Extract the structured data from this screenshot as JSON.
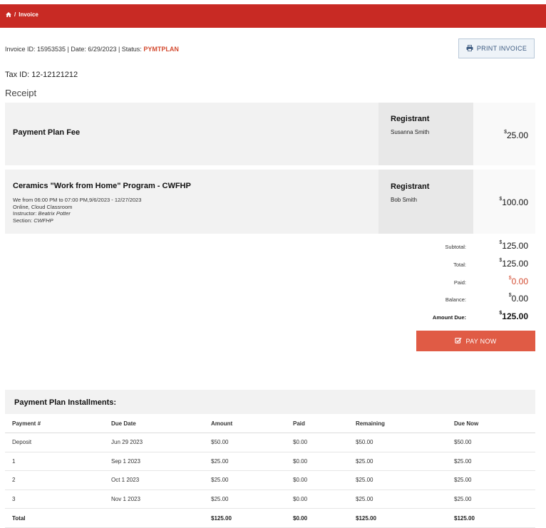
{
  "breadcrumb": {
    "home_icon": "home-icon",
    "separator": "/",
    "current": "Invoice"
  },
  "invoice_meta": {
    "prefix": "Invoice ID: 15953535 | Date: 6/29/2023 | Status: ",
    "status": "PYMTPLAN"
  },
  "print_button": {
    "icon": "printer-icon",
    "label": "PRINT INVOICE"
  },
  "tax_id": "Tax ID: 12-12121212",
  "section_title": "Receipt",
  "currency_symbol": "$",
  "items": [
    {
      "title": "Payment Plan Fee",
      "details": [],
      "registrant_label": "Registrant",
      "registrant_name": "Susanna Smith",
      "amount": "25.00"
    },
    {
      "title": "Ceramics \"Work from Home\" Program - CWFHP",
      "details": [
        {
          "text": "We from 06:00 PM to 07:00 PM,9/6/2023 - 12/27/2023"
        },
        {
          "text": "Online, Cloud Classroom"
        },
        {
          "label": "Instructor: ",
          "value": "Beatrix Potter"
        },
        {
          "label": "Section: ",
          "value": "CWFHP"
        }
      ],
      "registrant_label": "Registrant",
      "registrant_name": "Bob Smith",
      "amount": "100.00"
    }
  ],
  "totals": [
    {
      "label": "Subtotal:",
      "value": "125.00"
    },
    {
      "label": "Total:",
      "value": "125.00"
    },
    {
      "label": "Paid:",
      "value": "0.00"
    },
    {
      "label": "Balance:",
      "value": "0.00"
    },
    {
      "label": "Amount Due:",
      "value": "125.00"
    }
  ],
  "pay_button": {
    "icon": "checkbox-edit-icon",
    "label": "PAY NOW"
  },
  "installments": {
    "title": "Payment Plan Installments:",
    "columns": [
      "Payment #",
      "Due Date",
      "Amount",
      "Paid",
      "Remaining",
      "Due Now"
    ],
    "rows": [
      [
        "Deposit",
        "Jun 29 2023",
        "$50.00",
        "$0.00",
        "$50.00",
        "$50.00"
      ],
      [
        "1",
        "Sep 1 2023",
        "$25.00",
        "$0.00",
        "$25.00",
        "$25.00"
      ],
      [
        "2",
        "Oct 1 2023",
        "$25.00",
        "$0.00",
        "$25.00",
        "$25.00"
      ],
      [
        "3",
        "Nov 1 2023",
        "$25.00",
        "$0.00",
        "$25.00",
        "$25.00"
      ]
    ],
    "total_row": [
      "Total",
      "",
      "$125.00",
      "$0.00",
      "$125.00",
      "$125.00"
    ]
  },
  "colors": {
    "header_red": "#c82a24",
    "status_orange": "#d34a2f",
    "pay_button": "#e05b45",
    "print_button_bg": "#eef3f8",
    "print_button_text": "#3c5a80"
  }
}
